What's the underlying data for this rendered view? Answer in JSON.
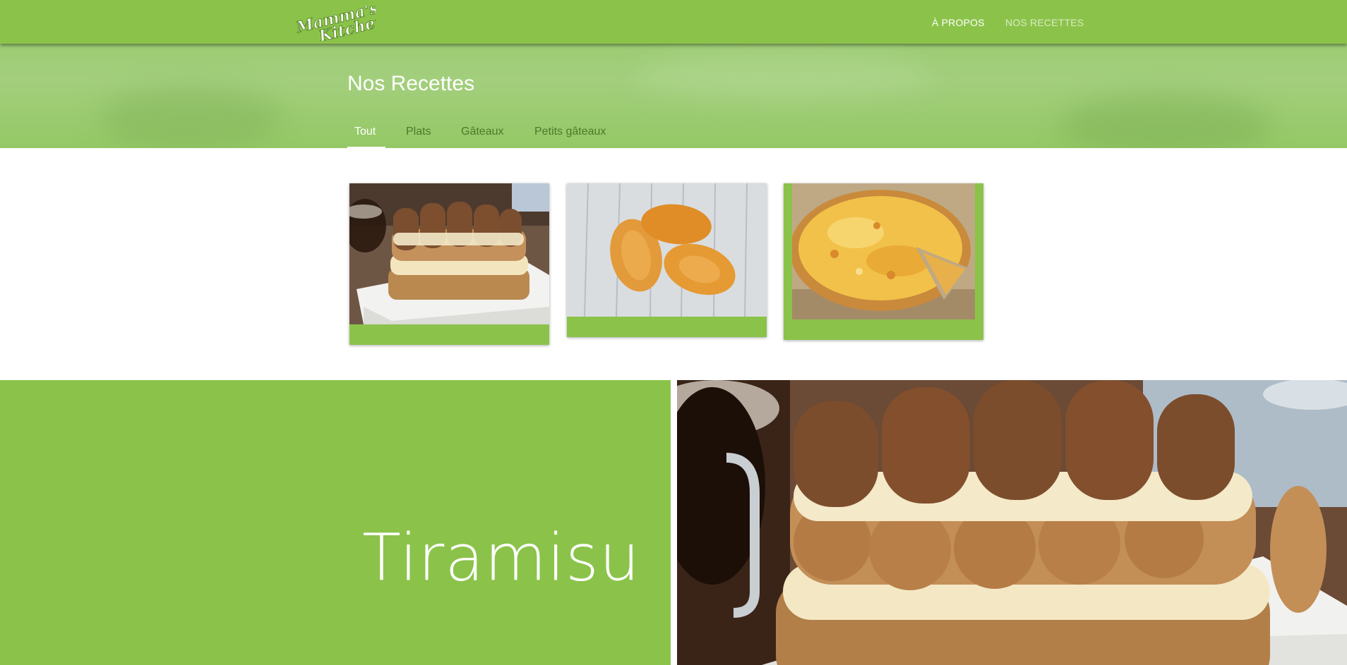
{
  "brand": {
    "logo_text": "Mamma's Kitchen"
  },
  "nav": {
    "about": "À PROPOS",
    "recipes": "NOS RECETTES"
  },
  "hero": {
    "title": "Nos Recettes"
  },
  "tabs": [
    {
      "label": "Tout",
      "active": true
    },
    {
      "label": "Plats",
      "active": false
    },
    {
      "label": "Gâteaux",
      "active": false
    },
    {
      "label": "Petits gâteaux",
      "active": false
    }
  ],
  "cards": [
    {
      "image": "tiramisu"
    },
    {
      "image": "madeleines"
    },
    {
      "image": "quiche"
    }
  ],
  "featured": {
    "title": "Tiramisu",
    "image": "tiramisu"
  },
  "colors": {
    "accent": "#8bc34a",
    "hero": "#a3cf7d",
    "text_on_accent": "#ffffff",
    "tab_text": "#4a7a28"
  }
}
